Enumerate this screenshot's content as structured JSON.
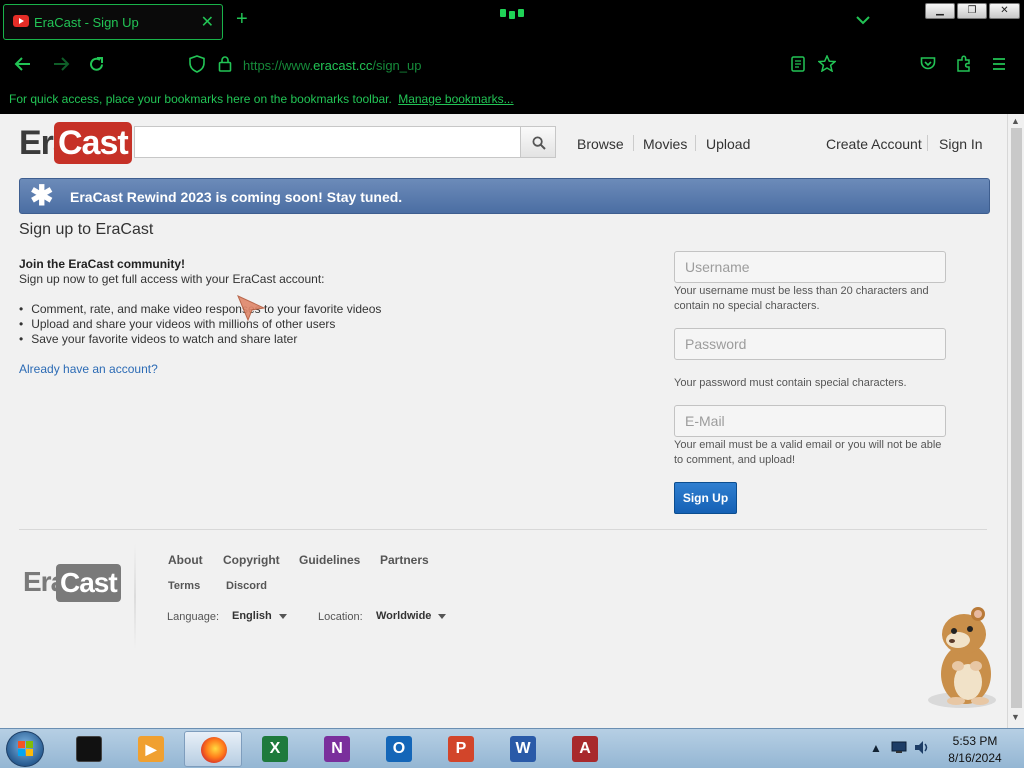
{
  "browser": {
    "tab_title": "EraCast - Sign Up",
    "url_scheme": "https://www.",
    "url_host": "eracast.cc",
    "url_path": "/sign_up",
    "bookmarks_hint": "For quick access, place your bookmarks here on the bookmarks toolbar.",
    "manage_bookmarks": "Manage bookmarks..."
  },
  "site": {
    "logo_era": "Era",
    "logo_cast": "Cast",
    "nav": [
      "Browse",
      "Movies",
      "Upload"
    ],
    "create_account": "Create Account",
    "sign_in": "Sign In",
    "banner": "EraCast Rewind 2023 is coming soon! Stay tuned."
  },
  "signup": {
    "title": "Sign up to EraCast",
    "intro_title": "Join the EraCast community!",
    "intro_sub": "Sign up now to get full access with your EraCast account:",
    "benefits": [
      "Comment, rate, and make video responses to your favorite videos",
      "Upload and share your videos with millions of other users",
      "Save your favorite videos to watch and share later"
    ],
    "login_link": "Already have an account?",
    "username_placeholder": "Username",
    "username_hint": "Your username must be less than 20 characters and contain no special characters.",
    "password_placeholder": "Password",
    "password_hint": "Your password must contain special characters.",
    "email_placeholder": "E-Mail",
    "email_hint": "Your email must be a valid email or you will not be able to comment, and upload!",
    "submit": "Sign Up"
  },
  "footer": {
    "links": [
      "About",
      "Copyright",
      "Guidelines",
      "Partners",
      "Terms",
      "Discord"
    ],
    "language_label": "Language:",
    "language_value": "English",
    "location_label": "Location:",
    "location_value": "Worldwide"
  },
  "taskbar": {
    "time": "5:53 PM",
    "date": "8/16/2024",
    "apps": [
      "black-box-app",
      "media-player-app",
      "firefox-app",
      "excel-app",
      "onenote-app",
      "outlook-app",
      "powerpoint-app",
      "word-app",
      "access-app"
    ]
  },
  "colors": {
    "browser_accent": "#22c455",
    "logo_red": "#c63127",
    "banner_blue": "#4b6ea3",
    "link_blue": "#2c6bb5",
    "signup_button": "#1561b5"
  }
}
